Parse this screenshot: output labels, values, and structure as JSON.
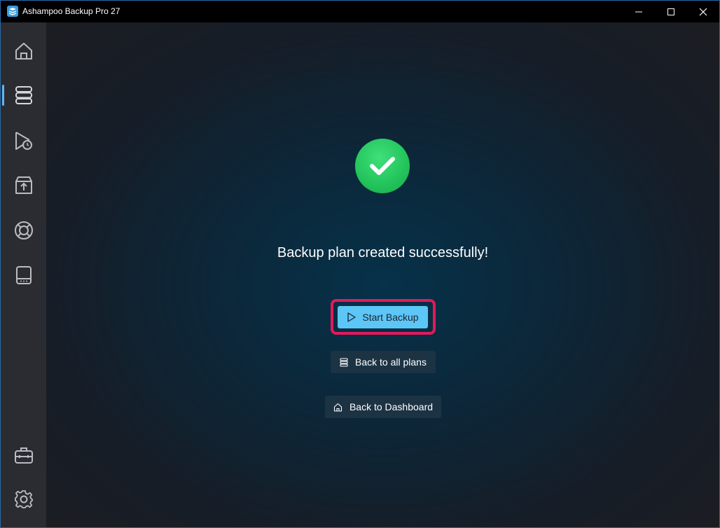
{
  "window": {
    "title": "Ashampoo Backup Pro 27",
    "app_icon": "ashampoo-backup-icon",
    "controls": [
      "minimize-icon",
      "maximize-icon",
      "close-icon"
    ]
  },
  "sidebar": {
    "items": [
      {
        "icon": "home-icon",
        "active": false
      },
      {
        "icon": "backup-plans-icon",
        "active": true
      },
      {
        "icon": "scheduled-backups-icon",
        "active": false
      },
      {
        "icon": "restore-icon",
        "active": false
      },
      {
        "icon": "rescue-icon",
        "active": false
      },
      {
        "icon": "drive-icon",
        "active": false
      }
    ],
    "bottom_items": [
      {
        "icon": "toolbox-icon"
      },
      {
        "icon": "gear-icon"
      }
    ]
  },
  "main": {
    "status_icon": "success-checkmark-icon",
    "headline": "Backup plan created successfully!",
    "buttons": {
      "start_backup": "Start Backup",
      "back_to_plans": "Back to all plans",
      "back_to_dashboard": "Back to Dashboard"
    }
  },
  "colors": {
    "accent": "#5cc6f7",
    "highlight": "#e3195a",
    "success": "#22c35a",
    "sidebar_bg": "#2a2c31",
    "titlebar_bg": "#000000"
  }
}
